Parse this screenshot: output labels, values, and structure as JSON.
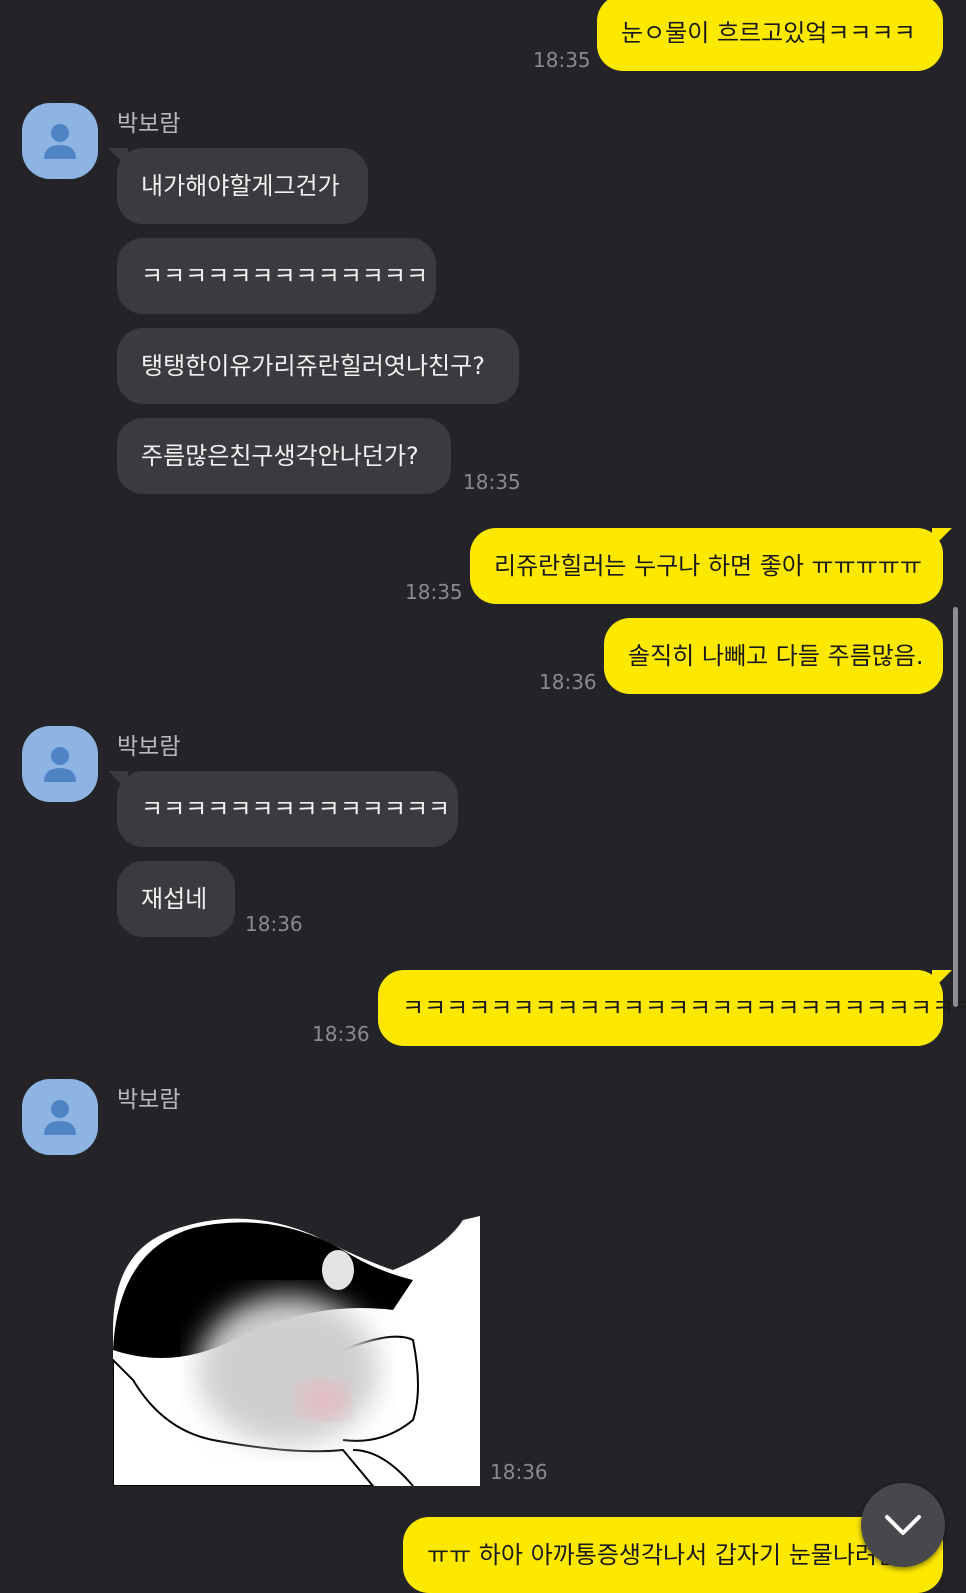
{
  "contact": {
    "name": "박보람"
  },
  "messages": {
    "m1": {
      "text": "눈ㅇ물이 흐르고있엌ㅋㅋㅋㅋ",
      "time": "18:35"
    },
    "m2": {
      "text": "내가해야할게그건가"
    },
    "m3": {
      "text": "ㅋㅋㅋㅋㅋㅋㅋㅋㅋㅋㅋㅋㅋ"
    },
    "m4": {
      "text": "탱탱한이유가리쥬란힐러엿나친구?"
    },
    "m5": {
      "text": "주름많은친구생각안나던가?",
      "time": "18:35"
    },
    "m6": {
      "text": "리쥬란힐러는 누구나 하면 좋아 ㅠㅠㅠㅠㅠ",
      "time": "18:35"
    },
    "m7": {
      "text": "솔직히 나빼고 다들 주름많음.",
      "time": "18:36"
    },
    "m8": {
      "text": "ㅋㅋㅋㅋㅋㅋㅋㅋㅋㅋㅋㅋㅋㅋ"
    },
    "m9": {
      "text": "재섭네",
      "time": "18:36"
    },
    "m10": {
      "text": "ㅋㅋㅋㅋㅋㅋㅋㅋㅋㅋㅋㅋㅋㅋㅋㅋㅋㅋㅋㅋㅋㅋㅋㅋㅋㅋㅋ",
      "time": "18:36"
    },
    "sticker": {
      "time": "18:36"
    },
    "m11": {
      "text": "ㅠㅠ 하아 아까통증생각나서 갑자기 눈물나려함"
    }
  },
  "icons": {
    "avatar": "person-icon",
    "scroll_down": "chevron-down-icon"
  },
  "colors": {
    "background": "#242428",
    "incoming_bubble": "#3b3b3f",
    "outgoing_bubble": "#fde900",
    "avatar": "#8db4e2",
    "timestamp": "#8a8a8e"
  }
}
